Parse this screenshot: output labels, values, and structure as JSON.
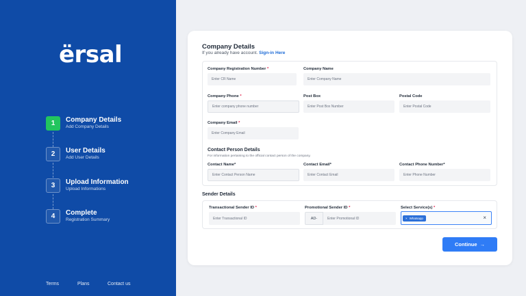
{
  "brand": {
    "logo_text": "ërsal"
  },
  "steps": [
    {
      "num": "1",
      "title": "Company Details",
      "subtitle": "Add Company Details",
      "active": true
    },
    {
      "num": "2",
      "title": "User Details",
      "subtitle": "Add User Details",
      "active": false
    },
    {
      "num": "3",
      "title": "Upload Information",
      "subtitle": "Upload Informations",
      "active": false
    },
    {
      "num": "4",
      "title": "Complete",
      "subtitle": "Registration Summary",
      "active": false
    }
  ],
  "footer": {
    "terms": "Terms",
    "plans": "Plans",
    "contact": "Contact us"
  },
  "form": {
    "title": "Company Details",
    "subtitle_text": "If you already have account.",
    "signin_link": "Sign-in Here",
    "company_reg_label": "Company Registration Number",
    "company_reg_placeholder": "Enter CR Name",
    "company_name_label": "Company Name",
    "company_name_placeholder": "Enter Company Name",
    "company_phone_label": "Company Phone",
    "company_phone_placeholder": "Enter company phone number",
    "post_box_label": "Post Box",
    "post_box_placeholder": "Enter Post Box Number",
    "postal_code_label": "Postal Code",
    "postal_code_placeholder": "Enter Postal Code",
    "company_email_label": "Company Email",
    "company_email_placeholder": "Enter Company Email",
    "contact_heading": "Contact Person Details",
    "contact_note": "For information pertaining to the official contact person of the company.",
    "contact_name_label": "Contact Name*",
    "contact_name_placeholder": "Enter Contact Person Name",
    "contact_email_label": "Contact Email*",
    "contact_email_placeholder": "Enter Contact Email",
    "contact_phone_label": "Contact Phone Number*",
    "contact_phone_placeholder": "Enter Phone Number",
    "required_mark": "*"
  },
  "sender": {
    "heading": "Sender Details",
    "transactional_label": "Transactional Sender ID",
    "transactional_placeholder": "Enter Transactional ID",
    "promotional_label": "Promotional Sender ID",
    "promotional_prefix": "AD-",
    "promotional_placeholder": "Enter Promotional ID",
    "services_label": "Select Service(s)",
    "selected_chip": "Whatsapp",
    "chip_remove": "×",
    "clear_icon": "×"
  },
  "actions": {
    "continue_label": "Continue",
    "continue_arrow": "→"
  },
  "colors": {
    "sidebar": "#0f4ba7",
    "active_step": "#22c55e",
    "primary": "#2f7cf6",
    "link": "#1d6bd6",
    "required": "#e11d48"
  }
}
